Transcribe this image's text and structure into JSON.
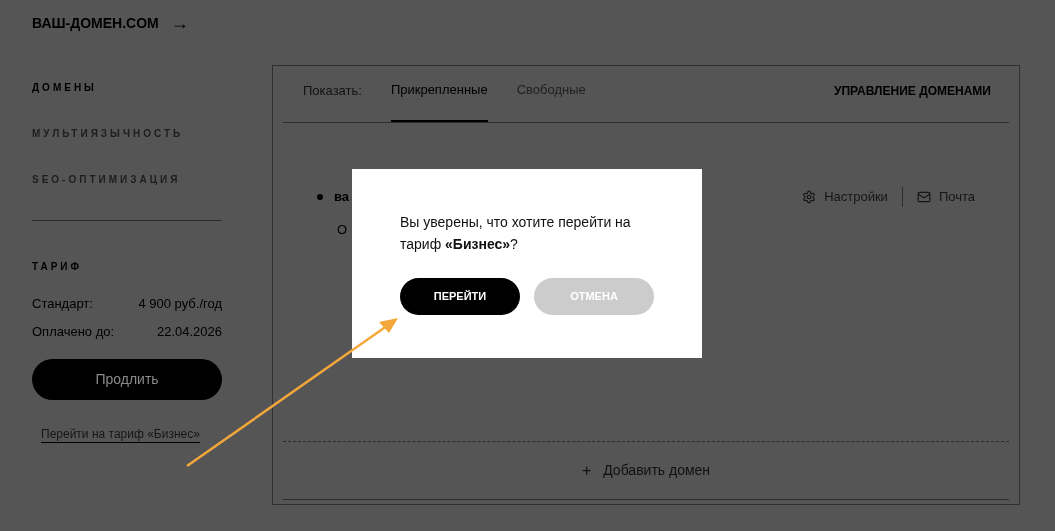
{
  "header": {
    "title": "ВАШ-ДОМЕН.COM",
    "arrow": "→"
  },
  "sidebar": {
    "items": [
      {
        "label": "ДОМЕНЫ",
        "selected": true
      },
      {
        "label": "МУЛЬТИЯЗЫЧНОСТЬ",
        "selected": false
      },
      {
        "label": "SEO-ОПТИМИЗАЦИЯ",
        "selected": false
      }
    ],
    "tariff": {
      "title": "ТАРИФ",
      "rows": [
        {
          "label": "Стандарт:",
          "value": "4 900 руб./год"
        },
        {
          "label": "Оплачено до:",
          "value": "22.04.2026"
        }
      ],
      "button": "Продлить",
      "link": "Перейти на тариф «Бизнес»"
    }
  },
  "main": {
    "show_label": "Показать:",
    "tabs": [
      {
        "label": "Прикрепленные",
        "selected": true
      },
      {
        "label": "Свободные",
        "selected": false
      }
    ],
    "manage": "УПРАВЛЕНИЕ ДОМЕНАМИ",
    "domain": {
      "name": "ва",
      "detail": "О",
      "actions": [
        {
          "kind": "settings",
          "label": "Настройки"
        },
        {
          "kind": "mail",
          "label": "Почта"
        }
      ]
    },
    "add": {
      "icon": "+",
      "label": "Добавить домен"
    }
  },
  "dialog": {
    "message": "Вы уверены, что хотите перейти на тариф **«Бизнес»**?",
    "buttons": [
      {
        "label": "ПЕРЕЙТИ",
        "kind": "primary"
      },
      {
        "label": "ОТМЕНА",
        "kind": "secondary"
      }
    ]
  }
}
